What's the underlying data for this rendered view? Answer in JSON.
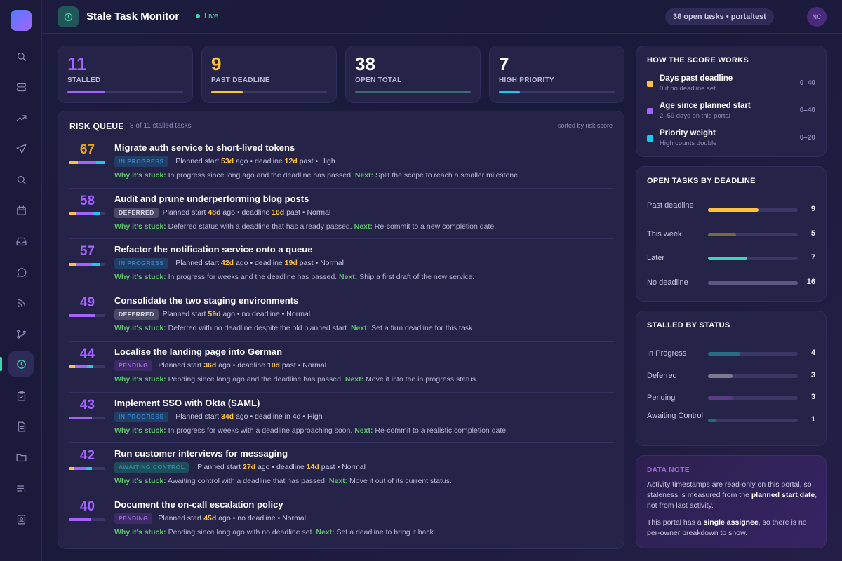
{
  "app": {
    "title": "Stale Task Monitor",
    "live": "Live",
    "pill": "38 open tasks • portaltest",
    "avatar": "NC"
  },
  "colors": {
    "accent": "#3ed6a8",
    "orange": "#ffc23d",
    "purple": "#a463ff",
    "cyan": "#1fc7f0",
    "score_high": "#e6a81f",
    "score_mid": "#a463ff"
  },
  "sidebar": {
    "icons": [
      "search-icon",
      "layers-icon",
      "trend-icon",
      "send-icon",
      "search-icon",
      "calendar-icon",
      "inbox-icon",
      "chat-icon",
      "rss-icon",
      "branch-icon",
      "clock-icon",
      "clipboard-icon",
      "document-icon",
      "folder-icon",
      "list-icon",
      "contact-icon"
    ],
    "active": "clock-icon"
  },
  "stats": [
    {
      "value": "11",
      "label": "STALLED",
      "color": "#a463ff",
      "level": 0.33
    },
    {
      "value": "9",
      "label": "PAST DEADLINE",
      "color": "#ffc23d",
      "level": 0.27
    },
    {
      "value": "38",
      "label": "OPEN TOTAL",
      "color": "#3d6a73",
      "level": 1.0
    },
    {
      "value": "7",
      "label": "HIGH PRIORITY",
      "color": "#1fc7f0",
      "level": 0.18
    }
  ],
  "queue": {
    "title": "RISK QUEUE",
    "subtitle": "8 of 11 stalled tasks",
    "sort": "sorted by risk score",
    "tasks": [
      {
        "score": "67",
        "title": "Migrate auth service to short-lived tokens",
        "status": "IN PROGRESS",
        "start": "53d",
        "deadline_pre": "deadline",
        "deadline": "12d",
        "deadline_post": "past",
        "priority": "High",
        "why": "In progress since long ago and the deadline has passed.",
        "next": "Split the scope to reach a smaller milestone."
      },
      {
        "score": "58",
        "title": "Audit and prune underperforming blog posts",
        "status": "DEFERRED",
        "start": "48d",
        "deadline_pre": "deadline",
        "deadline": "16d",
        "deadline_post": "past",
        "priority": "Normal",
        "why": "Deferred status with a deadline that has already passed.",
        "next": "Re-commit to a new completion date."
      },
      {
        "score": "57",
        "title": "Refactor the notification service onto a queue",
        "status": "IN PROGRESS",
        "start": "42d",
        "deadline_pre": "deadline",
        "deadline": "19d",
        "deadline_post": "past",
        "priority": "Normal",
        "why": "In progress for weeks and the deadline has passed.",
        "next": "Ship a first draft of the new service."
      },
      {
        "score": "49",
        "title": "Consolidate the two staging environments",
        "status": "DEFERRED",
        "start": "59d",
        "deadline_pre": "no deadline",
        "deadline": "",
        "deadline_post": "",
        "priority": "Normal",
        "why": "Deferred with no deadline despite the old planned start.",
        "next": "Set a firm deadline for this task."
      },
      {
        "score": "44",
        "title": "Localise the landing page into German",
        "status": "PENDING",
        "start": "36d",
        "deadline_pre": "deadline",
        "deadline": "10d",
        "deadline_post": "past",
        "priority": "Normal",
        "why": "Pending since long ago and the deadline has passed.",
        "next": "Move it into the in progress status."
      },
      {
        "score": "43",
        "title": "Implement SSO with Okta (SAML)",
        "status": "IN PROGRESS",
        "start": "34d",
        "deadline_pre": "deadline in 4d",
        "deadline": "",
        "deadline_post": "",
        "priority": "High",
        "why": "In progress for weeks with a deadline approaching soon.",
        "next": "Re-commit to a realistic completion date."
      },
      {
        "score": "42",
        "title": "Run customer interviews for messaging",
        "status": "AWAITING CONTROL",
        "start": "27d",
        "deadline_pre": "deadline",
        "deadline": "14d",
        "deadline_post": "past",
        "priority": "Normal",
        "why": "Awaiting control with a deadline that has passed.",
        "next": "Move it out of its current status."
      },
      {
        "score": "40",
        "title": "Document the on-call escalation policy",
        "status": "PENDING",
        "start": "45d",
        "deadline_pre": "no deadline",
        "deadline": "",
        "deadline_post": "",
        "priority": "Normal",
        "why": "Pending since long ago with no deadline set.",
        "next": "Set a deadline to bring it back."
      }
    ],
    "words": {
      "planned": "Planned start",
      "ago": "ago",
      "why": "Why it's stuck:",
      "next": "Next:"
    }
  },
  "score_works": {
    "title": "HOW THE SCORE WORKS",
    "items": [
      {
        "title": "Days past deadline",
        "sub": "0 if no deadline set",
        "range": "0–40",
        "color": "#ffc23d"
      },
      {
        "title": "Age since planned start",
        "sub": "2–59 days on this portal",
        "range": "0–40",
        "color": "#a463ff"
      },
      {
        "title": "Priority weight",
        "sub": "High counts double",
        "range": "0–20",
        "color": "#1fc7f0"
      }
    ]
  },
  "by_deadline": {
    "title": "OPEN TASKS BY DEADLINE",
    "rows": [
      {
        "label": "Past deadline",
        "value": "9",
        "level": 0.56,
        "color": "#ffc23d"
      },
      {
        "label": "This week",
        "value": "5",
        "level": 0.31,
        "color": "#7a6a3e"
      },
      {
        "label": "Later",
        "value": "7",
        "level": 0.44,
        "color": "#3ed6b8"
      },
      {
        "label": "No deadline",
        "value": "16",
        "level": 1.0,
        "color": "#5a5985"
      }
    ]
  },
  "by_status": {
    "title": "STALLED BY STATUS",
    "rows": [
      {
        "label": "In Progress",
        "value": "4",
        "level": 0.36,
        "color": "#2a6c82"
      },
      {
        "label": "Deferred",
        "value": "3",
        "level": 0.27,
        "color": "#7a7990"
      },
      {
        "label": "Pending",
        "value": "3",
        "level": 0.27,
        "color": "#5a3b88"
      },
      {
        "label": "Awaiting Control",
        "value": "1",
        "level": 0.09,
        "color": "#2a6a6e"
      }
    ]
  },
  "note": {
    "title": "DATA NOTE",
    "p1_a": "Activity timestamps are read-only on this portal, so staleness is measured from the ",
    "p1_b": "planned start date",
    "p1_c": ", not from last activity.",
    "p2_a": "This portal has a ",
    "p2_b": "single assignee",
    "p2_c": ", so there is no per-owner breakdown to show."
  }
}
